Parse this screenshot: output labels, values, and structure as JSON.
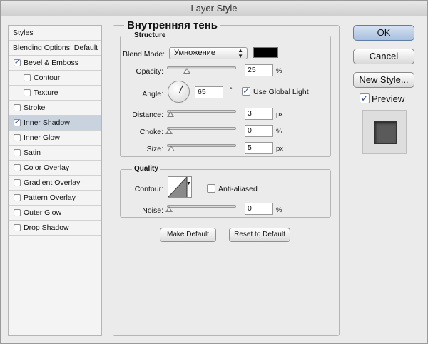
{
  "window": {
    "title": "Layer Style"
  },
  "sidebar": {
    "header": "Styles",
    "items": [
      {
        "label": "Blending Options: Default",
        "checkbox": false,
        "checked": false,
        "selected": false
      },
      {
        "label": "Bevel & Emboss",
        "checkbox": true,
        "checked": true,
        "selected": false
      },
      {
        "label": "Contour",
        "checkbox": true,
        "checked": false,
        "selected": false,
        "indent": true
      },
      {
        "label": "Texture",
        "checkbox": true,
        "checked": false,
        "selected": false,
        "indent": true
      },
      {
        "label": "Stroke",
        "checkbox": true,
        "checked": false,
        "selected": false
      },
      {
        "label": "Inner Shadow",
        "checkbox": true,
        "checked": true,
        "selected": true
      },
      {
        "label": "Inner Glow",
        "checkbox": true,
        "checked": false,
        "selected": false
      },
      {
        "label": "Satin",
        "checkbox": true,
        "checked": false,
        "selected": false
      },
      {
        "label": "Color Overlay",
        "checkbox": true,
        "checked": false,
        "selected": false
      },
      {
        "label": "Gradient Overlay",
        "checkbox": true,
        "checked": false,
        "selected": false
      },
      {
        "label": "Pattern Overlay",
        "checkbox": true,
        "checked": false,
        "selected": false
      },
      {
        "label": "Outer Glow",
        "checkbox": true,
        "checked": false,
        "selected": false
      },
      {
        "label": "Drop Shadow",
        "checkbox": true,
        "checked": false,
        "selected": false
      }
    ]
  },
  "panel": {
    "title": "Внутренняя тень",
    "structure": {
      "title": "Structure",
      "blend_mode_label": "Blend Mode:",
      "blend_mode_value": "Умножение",
      "shadow_color": "#000000",
      "opacity_label": "Opacity:",
      "opacity_value": "25",
      "opacity_unit": "%",
      "angle_label": "Angle:",
      "angle_value": "65",
      "angle_unit": "°",
      "use_global_light_label": "Use Global Light",
      "use_global_light": true,
      "distance_label": "Distance:",
      "distance_value": "3",
      "distance_unit": "px",
      "choke_label": "Choke:",
      "choke_value": "0",
      "choke_unit": "%",
      "size_label": "Size:",
      "size_value": "5",
      "size_unit": "px"
    },
    "quality": {
      "title": "Quality",
      "contour_label": "Contour:",
      "anti_aliased_label": "Anti-aliased",
      "anti_aliased": false,
      "noise_label": "Noise:",
      "noise_value": "0",
      "noise_unit": "%"
    },
    "make_default_label": "Make Default",
    "reset_default_label": "Reset to Default"
  },
  "buttons": {
    "ok": "OK",
    "cancel": "Cancel",
    "new_style": "New Style...",
    "preview_label": "Preview",
    "preview_checked": true
  },
  "colors": {
    "selected_row": "#c9d3e0",
    "default_button": "#a7bfdd"
  }
}
